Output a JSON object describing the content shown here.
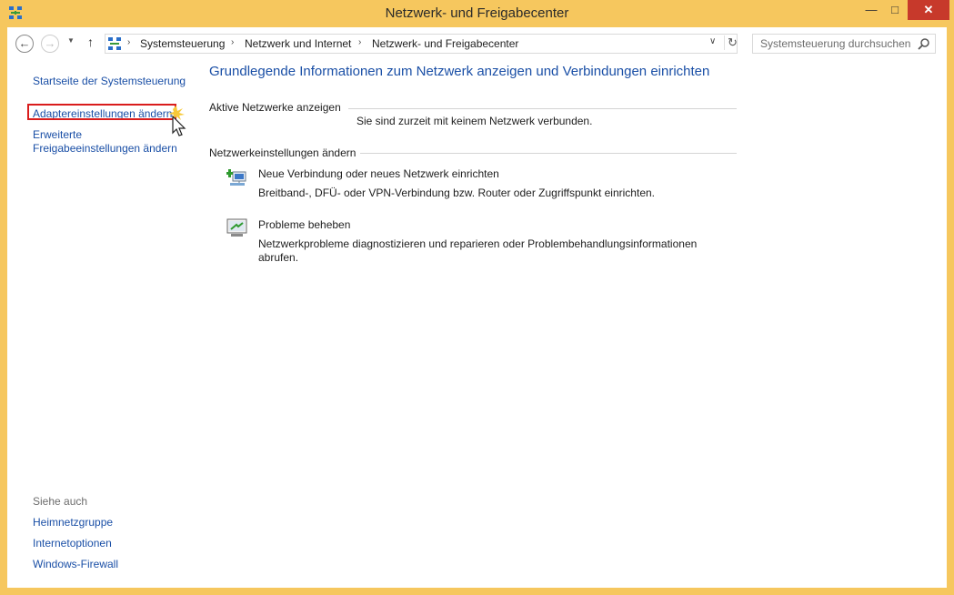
{
  "window": {
    "title": "Netzwerk- und Freigabecenter",
    "controls": {
      "minimize": "—",
      "maximize": "□",
      "close": "✕"
    },
    "frame_color": "#f6c75e"
  },
  "navbar": {
    "back_glyph": "←",
    "forward_glyph": "→",
    "recent_glyph": "▼",
    "up_glyph": "↑",
    "breadcrumbs": [
      "Systemsteuerung",
      "Netzwerk und Internet",
      "Netzwerk- und Freigabecenter"
    ],
    "separator": "›",
    "dropdown_glyph": "∨",
    "refresh_glyph": "↻",
    "search_placeholder": "Systemsteuerung durchsuchen"
  },
  "sidebar": {
    "home": "Startseite der Systemsteuerung",
    "items": [
      "Adaptereinstellungen ändern",
      "Erweiterte",
      "Freigabeeinstellungen ändern"
    ],
    "see_also_title": "Siehe auch",
    "see_also": [
      "Heimnetzgruppe",
      "Internetoptionen",
      "Windows-Firewall"
    ]
  },
  "main": {
    "heading": "Grundlegende Informationen zum Netzwerk anzeigen und Verbindungen einrichten",
    "active_networks_label": "Aktive Netzwerke anzeigen",
    "no_network_text": "Sie sind zurzeit mit keinem Netzwerk verbunden.",
    "change_settings_label": "Netzwerkeinstellungen ändern",
    "tasks": [
      {
        "title": "Neue Verbindung oder neues Netzwerk einrichten",
        "desc": "Breitband-, DFÜ- oder VPN-Verbindung bzw. Router oder Zugriffspunkt einrichten.",
        "icon": "new-connection-icon"
      },
      {
        "title": "Probleme beheben",
        "desc_line1": "Netzwerkprobleme diagnostizieren und reparieren oder Problembehandlungsinformationen",
        "desc_line2": "abrufen.",
        "icon": "troubleshoot-icon"
      }
    ]
  },
  "colors": {
    "link": "#1a4fa6",
    "highlight": "#d91c1c",
    "close": "#c7392b"
  }
}
